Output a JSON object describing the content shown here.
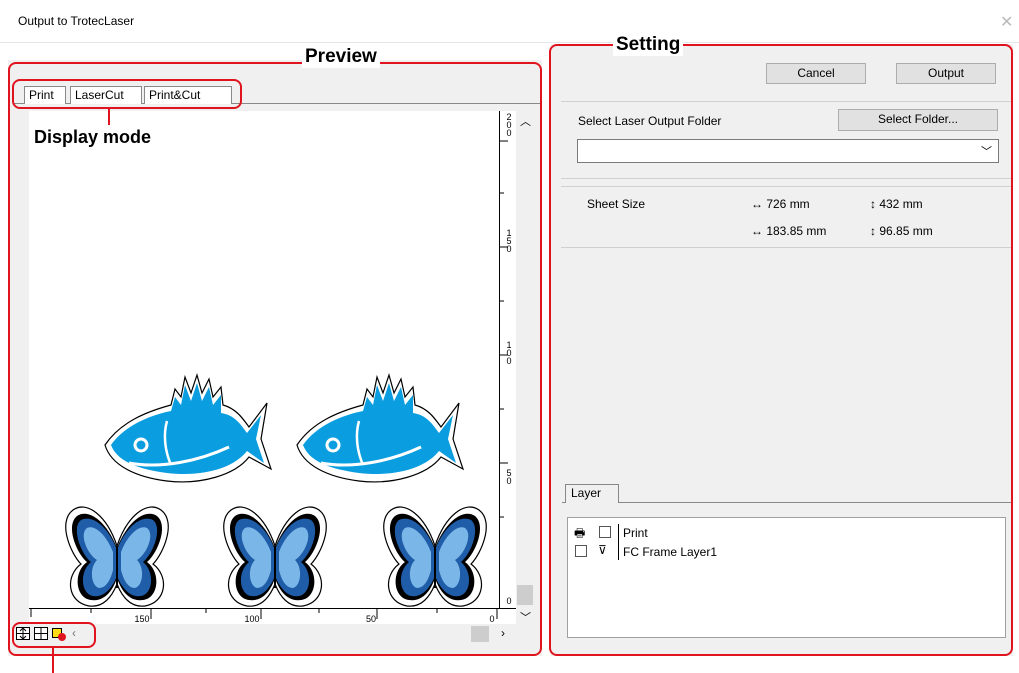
{
  "window": {
    "title": "Output to TrotecLaser"
  },
  "annotations": {
    "preview": "Preview",
    "setting": "Setting",
    "display_mode": "Display mode"
  },
  "tabs": [
    "Print",
    "LaserCut",
    "Print&Cut"
  ],
  "ruler": {
    "vertical": [
      "200",
      "150",
      "100",
      "50",
      "0"
    ],
    "horizontal": [
      "150",
      "100",
      "50",
      "0"
    ]
  },
  "buttons": {
    "cancel": "Cancel",
    "output": "Output",
    "select_folder": "Select Folder..."
  },
  "folder": {
    "label": "Select Laser Output Folder",
    "value": ""
  },
  "sheet": {
    "label": "Sheet Size",
    "width_1": "↔ 726 mm",
    "height_1": "↕ 432 mm",
    "width_2": "↔ 183.85 mm",
    "height_2": "↕ 96.85 mm"
  },
  "layer_panel": {
    "tab": "Layer",
    "items": [
      "Print",
      "FC Frame Layer1"
    ]
  },
  "colors": {
    "annotation": "#e0141e",
    "fish": "#0a9ee0",
    "butterfly_dark": "#1f5da8",
    "butterfly_light": "#7ab6e8"
  }
}
